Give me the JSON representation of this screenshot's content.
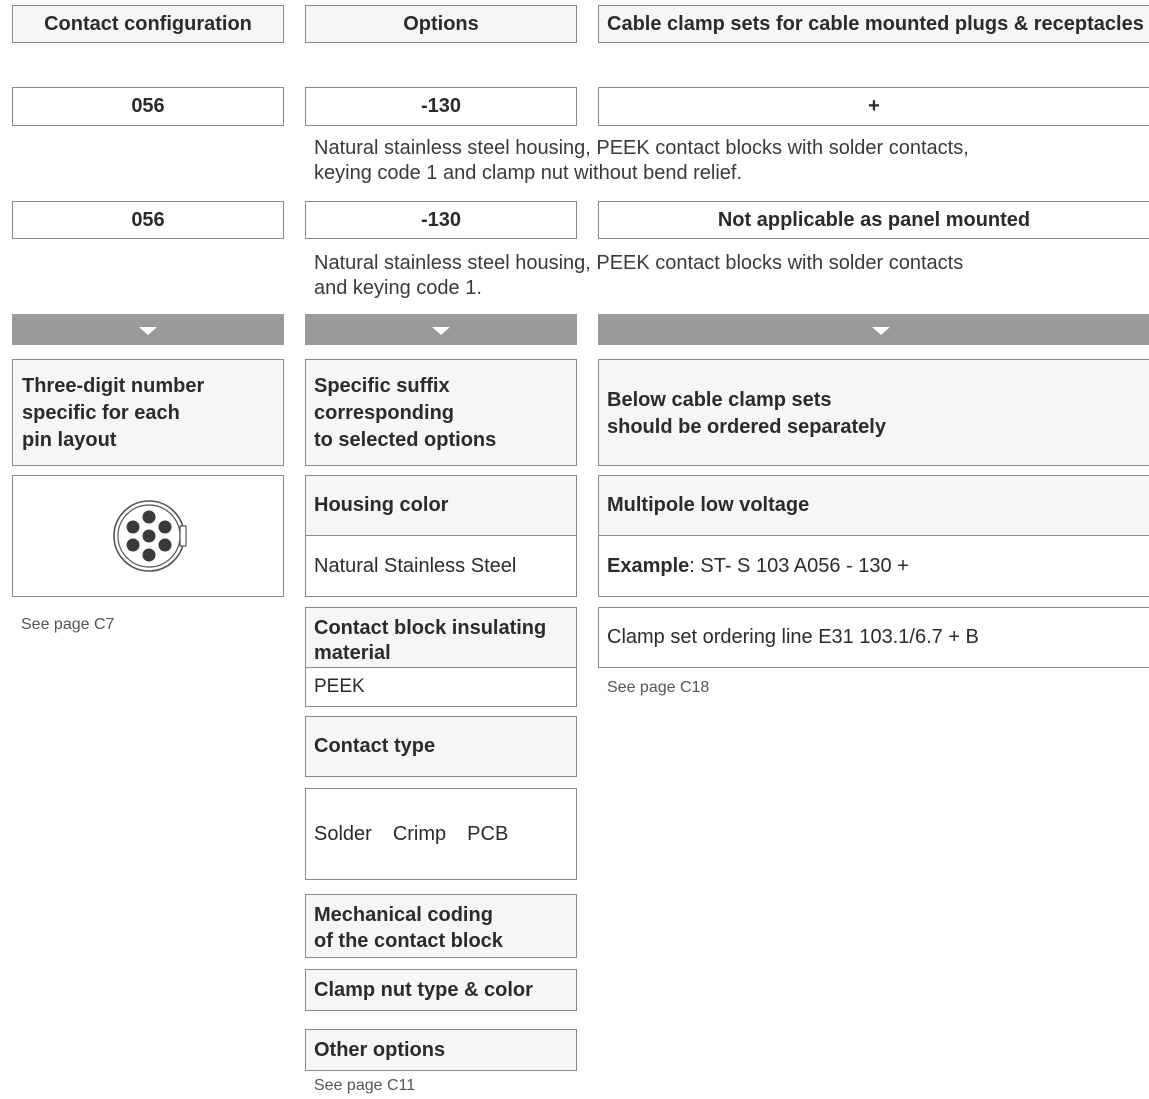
{
  "headers": {
    "contact_configuration": "Contact configuration",
    "options": "Options",
    "cable_clamp": "Cable clamp sets for cable mounted plugs & receptacles"
  },
  "row1": {
    "config": "056",
    "option": "-130",
    "clamp": "+",
    "description_line1": "Natural stainless steel housing, PEEK contact blocks with solder contacts,",
    "description_line2": "keying code 1 and clamp nut without bend relief."
  },
  "row2": {
    "config": "056",
    "option": "-130",
    "clamp": "Not applicable as panel mounted",
    "description_line1": "Natural stainless steel housing, PEEK contact blocks with solder contacts",
    "description_line2": "and keying code 1."
  },
  "explain": {
    "config_line1": "Three-digit number",
    "config_line2": "specific for each",
    "config_line3": "pin layout",
    "options_line1": "Specific suffix",
    "options_line2": "corresponding",
    "options_line3": "to selected options",
    "clamp_line1": "Below cable clamp sets",
    "clamp_line2": "should be ordered separately"
  },
  "config_ref": "See page C7",
  "options_list": {
    "housing_color_label": "Housing color",
    "housing_color_value": "Natural Stainless Steel",
    "insulating_label_line1": "Contact block insulating",
    "insulating_label_line2": "material",
    "insulating_value": "PEEK",
    "contact_type_label": "Contact type",
    "contact_types": [
      "Solder",
      "Crimp",
      "PCB"
    ],
    "mech_coding_line1": "Mechanical coding",
    "mech_coding_line2": "of the contact block",
    "clamp_nut_label": "Clamp nut type & color",
    "other_options_label": "Other options",
    "ref": "See page C11"
  },
  "clamp_list": {
    "multipole_label": "Multipole low voltage",
    "example_label": "Example",
    "example_value": ": ST- S 103 A056 - 130 +",
    "ordering_line": "Clamp set ordering line E31 103.1/6.7 + B",
    "ref": "See page C18"
  },
  "icons": {
    "connector": "7-pin-connector-face-icon",
    "arrow": "triangle-down-icon"
  },
  "colors": {
    "border": "#8a8a8a",
    "bar": "#9a9a9a",
    "label_bg": "#f6f6f6",
    "pin": "#3a3a3a"
  }
}
